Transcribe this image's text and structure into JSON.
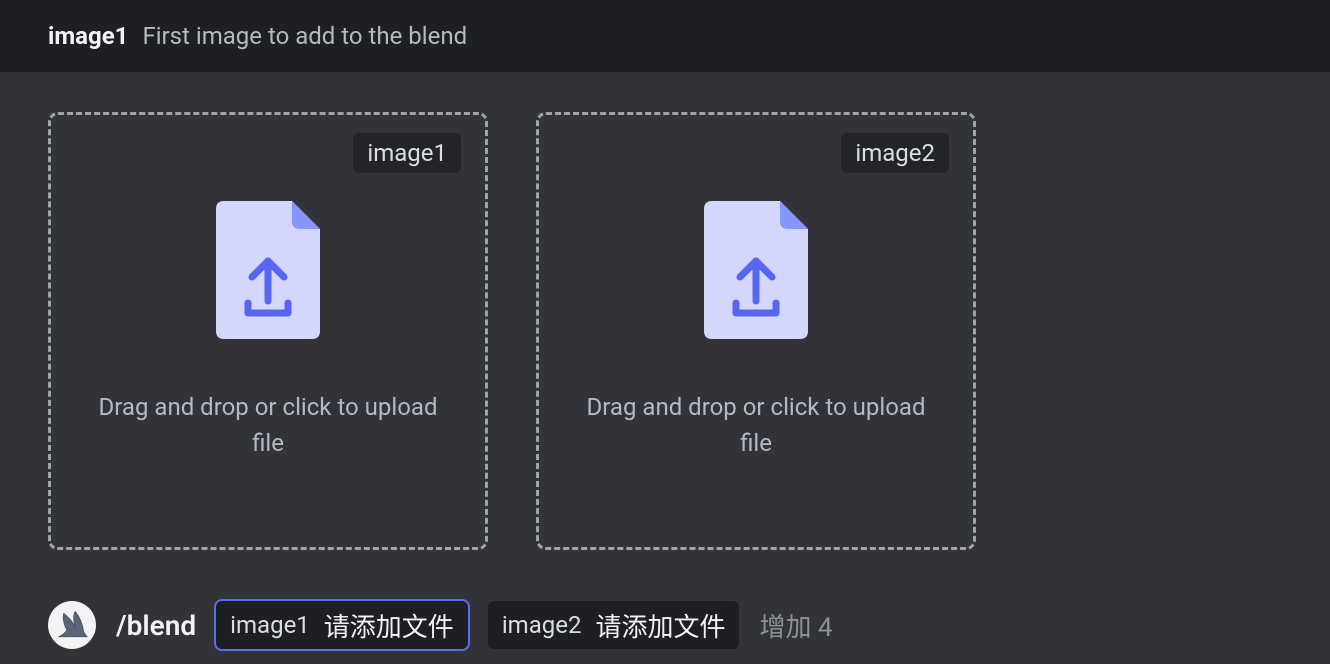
{
  "header": {
    "param_name": "image1",
    "description": "First image to add to the blend"
  },
  "dropzones": [
    {
      "tag": "image1",
      "prompt": "Drag and drop or click to upload file"
    },
    {
      "tag": "image2",
      "prompt": "Drag and drop or click to upload file"
    }
  ],
  "input": {
    "command": "/blend",
    "params": [
      {
        "name": "image1",
        "placeholder": "请添加文件",
        "active": true
      },
      {
        "name": "image2",
        "placeholder": "请添加文件",
        "active": false
      }
    ],
    "more_label": "增加 4"
  }
}
